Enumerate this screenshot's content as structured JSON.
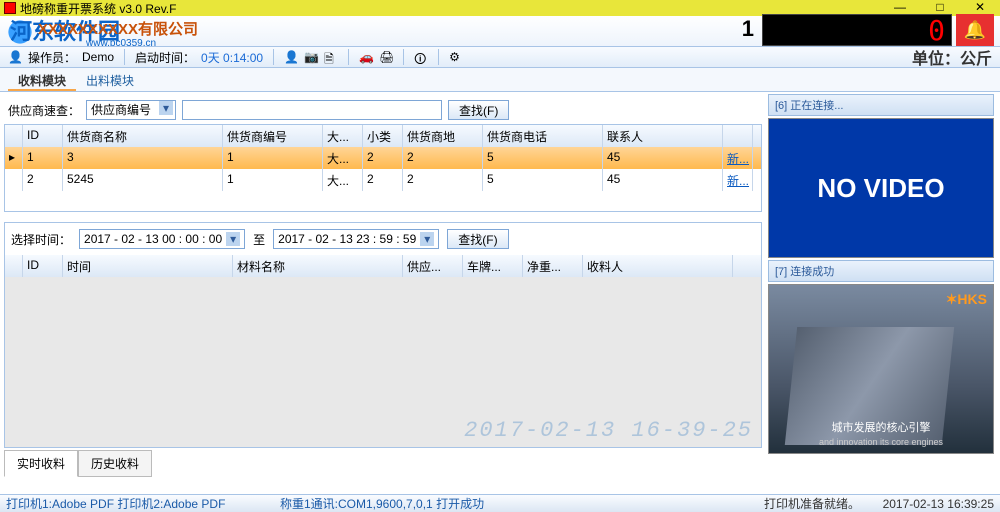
{
  "window": {
    "title": "地磅称重开票系统  v3.0 Rev.F",
    "min": "—",
    "max": "□",
    "close": "✕"
  },
  "watermark": {
    "main": "河东软件园",
    "sub": "www.pc0359.cn"
  },
  "company": "XXXXXXXXXX有限公司",
  "lcd": {
    "index": "1",
    "value": "0"
  },
  "toolbar": {
    "operator_label": "操作员：",
    "operator": "Demo",
    "runtime_label": "启动时间：",
    "runtime": "0天 0:14:00",
    "unit": "单位：公斤"
  },
  "tabs": {
    "a": "收料模块",
    "b": "出料模块"
  },
  "supplier": {
    "quick_label": "供应商速查：",
    "combo": "供应商编号",
    "search_btn": "查找(F)",
    "cols": {
      "id": "ID",
      "name": "供货商名称",
      "no": "供货商编号",
      "big": "大...",
      "small": "小类",
      "area": "供货商地",
      "tel": "供货商电话",
      "contact": "联系人"
    },
    "rows": [
      {
        "ptr": "▸",
        "id": "1",
        "name": "3",
        "no": "1",
        "big": "大...",
        "small": "2",
        "area": "2",
        "tel": "5",
        "contact": "45",
        "edit": "新..."
      },
      {
        "ptr": "",
        "id": "2",
        "name": "5245",
        "no": "1",
        "big": "大...",
        "small": "2",
        "area": "2",
        "tel": "5",
        "contact": "45",
        "edit": "新..."
      }
    ]
  },
  "date": {
    "label": "选择时间：",
    "from": "2017 - 02 - 13   00 : 00 : 00",
    "to_label": "至",
    "to": "2017 - 02 - 13   23 : 59 : 59",
    "search": "查找(F)"
  },
  "grid2_cols": {
    "id": "ID",
    "time": "时间",
    "mat": "材料名称",
    "sup": "供应...",
    "plate": "车牌...",
    "net": "净重...",
    "recv": "收料人"
  },
  "watermark_ts": "2017-02-13 16-39-25",
  "btabs": {
    "a": "实时收料",
    "b": "历史收料"
  },
  "rpanel": {
    "lab1": "[6] 正在连接...",
    "novideo": "NO VIDEO",
    "lab2": "[7] 连接成功",
    "vlogo": "✶HKS",
    "vcap": "城市发展的核心引擎",
    "vcap2": "and innovation its core engines"
  },
  "status": {
    "left": "打印机1:Adobe PDF  打印机2:Adobe PDF",
    "mid": "称重1通讯:COM1,9600,7,0,1 打开成功",
    "r1": "打印机准备就绪。",
    "r2": "2017-02-13 16:39:25"
  },
  "icons": {
    "user": "👤",
    "cam": "📷",
    "doc": "🗎",
    "car": "🚗",
    "print": "🖨",
    "rss": "🛈",
    "gear": "⚙",
    "bell": "🔔",
    "drop": "▾"
  }
}
